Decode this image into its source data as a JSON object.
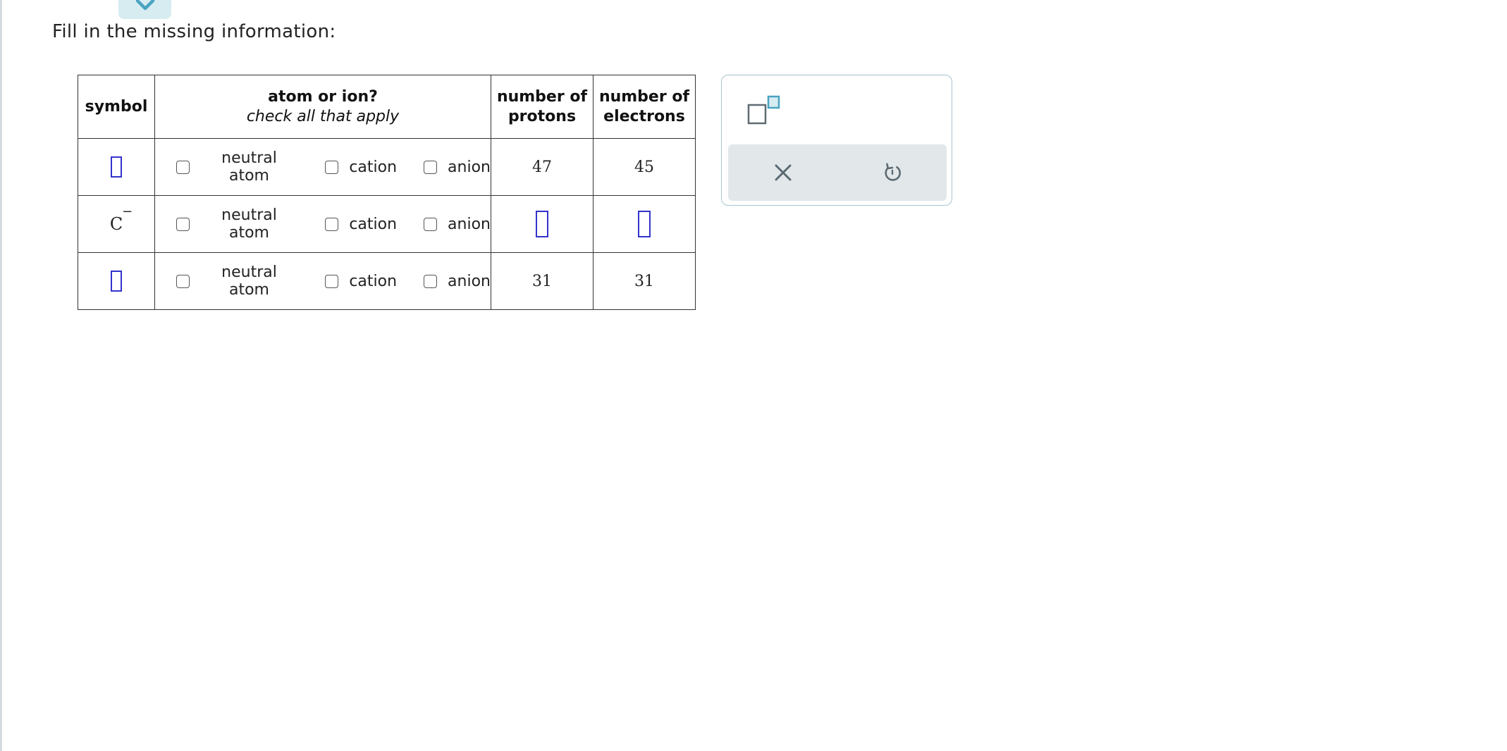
{
  "prompt": "Fill in the missing information:",
  "table": {
    "headers": {
      "symbol": "symbol",
      "atom_or_ion": "atom or ion?",
      "atom_or_ion_sub": "check all that apply",
      "protons_line1": "number of",
      "protons_line2": "protons",
      "electrons_line1": "number of",
      "electrons_line2": "electrons"
    },
    "option_labels": [
      "neutral atom",
      "cation",
      "anion"
    ],
    "rows": [
      {
        "symbol": "",
        "charge": "",
        "protons": "47",
        "electrons": "45"
      },
      {
        "symbol": "C",
        "charge": "−",
        "protons": "",
        "electrons": ""
      },
      {
        "symbol": "",
        "charge": "",
        "protons": "31",
        "electrons": "31"
      }
    ]
  },
  "tools": {
    "superscript_icon": "superscript-box-icon",
    "clear_icon": "close-icon",
    "undo_icon": "undo-icon"
  },
  "colors": {
    "blank_border": "#3333cc",
    "tool_accent": "#4aa3c2",
    "tool_bar": "#e2e7ea"
  }
}
